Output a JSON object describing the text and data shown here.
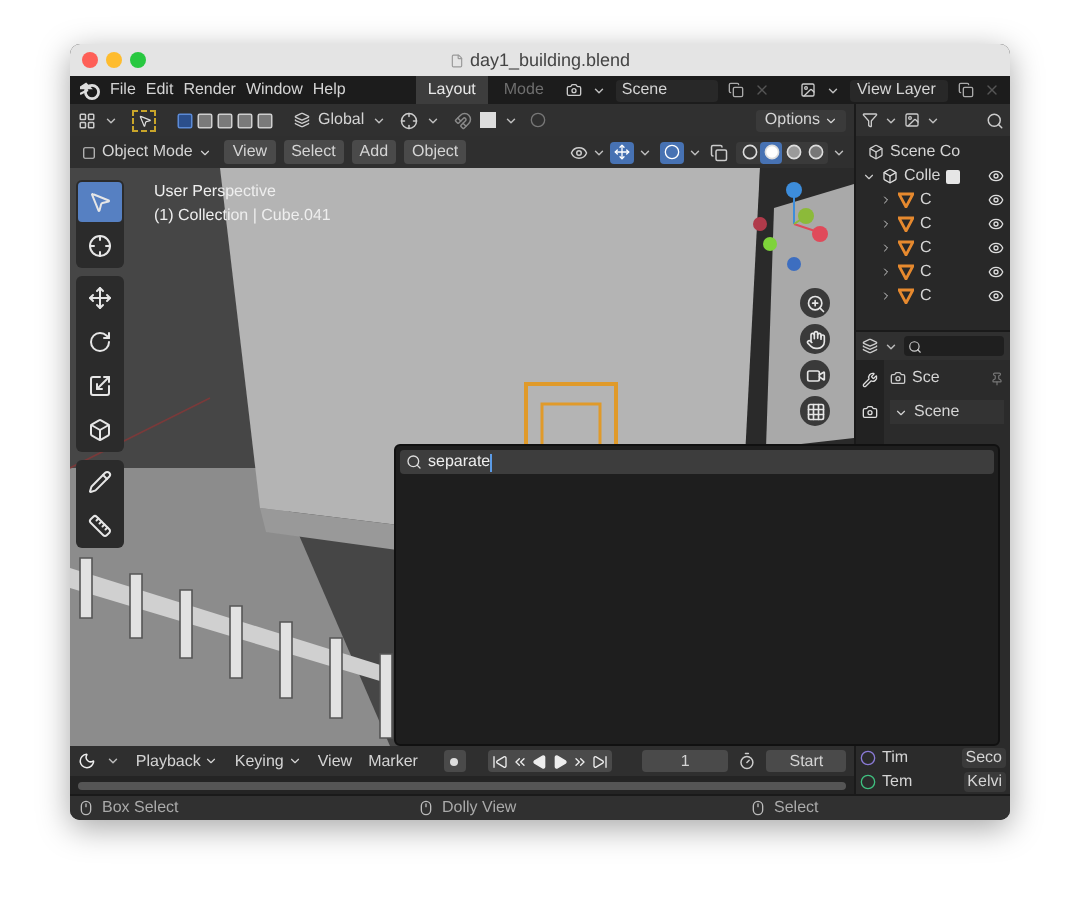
{
  "window": {
    "title": "day1_building.blend"
  },
  "menu": [
    "File",
    "Edit",
    "Render",
    "Window",
    "Help"
  ],
  "workspaces": [
    {
      "label": "Layout",
      "selected": true
    },
    {
      "label": "Mode",
      "selected": false
    }
  ],
  "scene": "Scene",
  "view_layer": "View Layer",
  "tool_header": {
    "orientation": "Global",
    "options": "Options"
  },
  "viewport_header": {
    "mode": "Object Mode",
    "menus": [
      "View",
      "Select",
      "Add",
      "Object"
    ]
  },
  "shading": [
    {
      "kind": "wireframe",
      "selected": false
    },
    {
      "kind": "solid",
      "selected": true
    },
    {
      "kind": "material",
      "selected": false
    },
    {
      "kind": "rendered",
      "selected": false
    }
  ],
  "viewport": {
    "overlay_lines": [
      "User Perspective",
      "(1) Collection | Cube.041"
    ]
  },
  "tool_groups": [
    [
      {
        "kind": "select",
        "selected": true
      },
      {
        "kind": "cursor",
        "selected": false
      }
    ],
    [
      {
        "kind": "move",
        "selected": false
      },
      {
        "kind": "rotate",
        "selected": false
      },
      {
        "kind": "scale",
        "selected": false
      },
      {
        "kind": "transform",
        "selected": false
      }
    ],
    [
      {
        "kind": "annotate",
        "selected": false
      },
      {
        "kind": "measure",
        "selected": false
      }
    ]
  ],
  "outliner": {
    "root": "Scene Co",
    "collection": {
      "label": "Colle",
      "expanded": true,
      "checked": true,
      "visible": true,
      "children": [
        {
          "label": "C",
          "expanded": false,
          "visible": true
        },
        {
          "label": "C",
          "expanded": false,
          "visible": true
        },
        {
          "label": "C",
          "expanded": false,
          "visible": true
        },
        {
          "label": "C",
          "expanded": false,
          "visible": true
        },
        {
          "label": "C",
          "expanded": false,
          "visible": true
        }
      ]
    }
  },
  "properties": {
    "scene": "Sce",
    "section": {
      "label": "Scene",
      "expanded": true
    }
  },
  "search": {
    "value": "separate"
  },
  "timeline": {
    "menus": [
      {
        "label": "Playback",
        "dropdown": true
      },
      {
        "label": "Keying",
        "dropdown": true
      },
      {
        "label": "View",
        "dropdown": false
      },
      {
        "label": "Marker",
        "dropdown": false
      }
    ],
    "frame": "1",
    "start": "Start"
  },
  "side_rows": [
    {
      "label": "Tim",
      "value": "Seco"
    },
    {
      "label": "Tem",
      "value": "Kelvi"
    }
  ],
  "status_bar": [
    "Box Select",
    "Dolly View",
    "Select"
  ]
}
